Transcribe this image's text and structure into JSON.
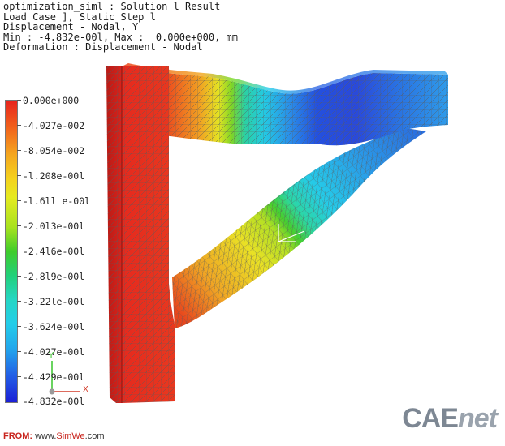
{
  "header": {
    "line1": "optimization_siml : Solution l Result",
    "line2": "Load Case ], Static Step l",
    "line3": "Displacement - Nodal, Y",
    "line4": "Min : -4.832e-00l, Max :  0.000e+000, mm",
    "line5": "Deformation : Displacement - Nodal"
  },
  "legend": {
    "ticks": [
      "0.000e+000",
      "-4.027e-002",
      "-8.054e-002",
      "-l.208e-00l",
      "-l.6ll e-00l",
      "-2.0l3e-00l",
      "-2.4l6e-00l",
      "-2.8l9e-00l",
      "-3.22le-00l",
      "-3.624e-00l",
      "-4.027e-00l",
      "-4.429e-00l",
      "-4.832e-00l"
    ]
  },
  "axes": {
    "x": "X",
    "y": "Y"
  },
  "footer": {
    "from_label": "FROM:",
    "url_prefix": "www.",
    "url_highlight": "SimWe",
    "url_suffix": ".com"
  },
  "logo": {
    "cae": "CAE",
    "net": "net"
  },
  "colors": {
    "max": "#e8231d",
    "min": "#1b1fd6",
    "mesh": "#6a6a6a"
  }
}
